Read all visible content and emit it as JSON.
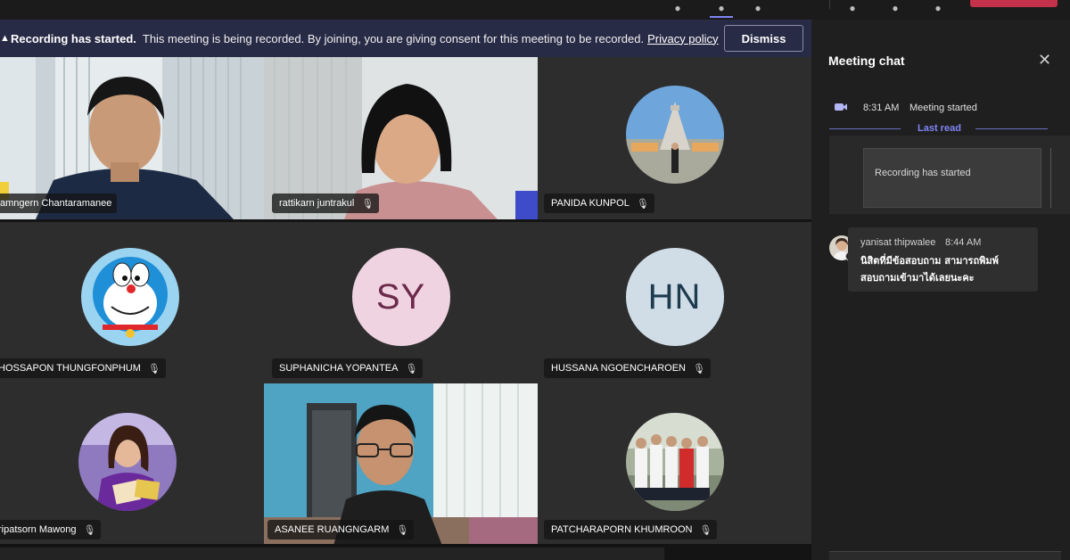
{
  "banner": {
    "title": "Recording has started.",
    "message": "This meeting is being recorded. By joining, you are giving consent for this meeting to be recorded.",
    "link": "Privacy policy",
    "dismiss_label": "Dismiss"
  },
  "participants": [
    {
      "name": "amngern Chantaramanee",
      "kind": "video"
    },
    {
      "name": "rattikarn juntrakul",
      "kind": "video"
    },
    {
      "name": "PANIDA KUNPOL",
      "kind": "photo"
    },
    {
      "name": "HOSSAPON THUNGFONPHUM",
      "kind": "photo"
    },
    {
      "name": "SUPHANICHA YOPANTEA",
      "kind": "initials",
      "initials": "SY"
    },
    {
      "name": "HUSSANA NGOENCHAROEN",
      "kind": "initials",
      "initials": "HN"
    },
    {
      "name": "ripatsorn Mawong",
      "kind": "photo"
    },
    {
      "name": "ASANEE RUANGNGARM",
      "kind": "video"
    },
    {
      "name": "PATCHARAPORN KHUMROON",
      "kind": "photo"
    }
  ],
  "chat": {
    "title": "Meeting chat",
    "event_time": "8:31 AM",
    "event_text": "Meeting started",
    "last_read": "Last read",
    "recording_card": "Recording has started",
    "message": {
      "author": "yanisat thipwalee",
      "time": "8:44 AM",
      "line1": "นิสิตที่มีข้อสอบถาม สามารถพิมพ์",
      "line2": "สอบถามเข้ามาได้เลยนะคะ"
    }
  },
  "colors": {
    "banner_bg": "#282b45",
    "accent": "#7f85f5",
    "leave_red": "#c4314b",
    "sy_avatar_bg": "#f0d3e1",
    "sy_avatar_fg": "#6b2a49",
    "hn_avatar_bg": "#d0dde6",
    "hn_avatar_fg": "#1e3a4f"
  }
}
